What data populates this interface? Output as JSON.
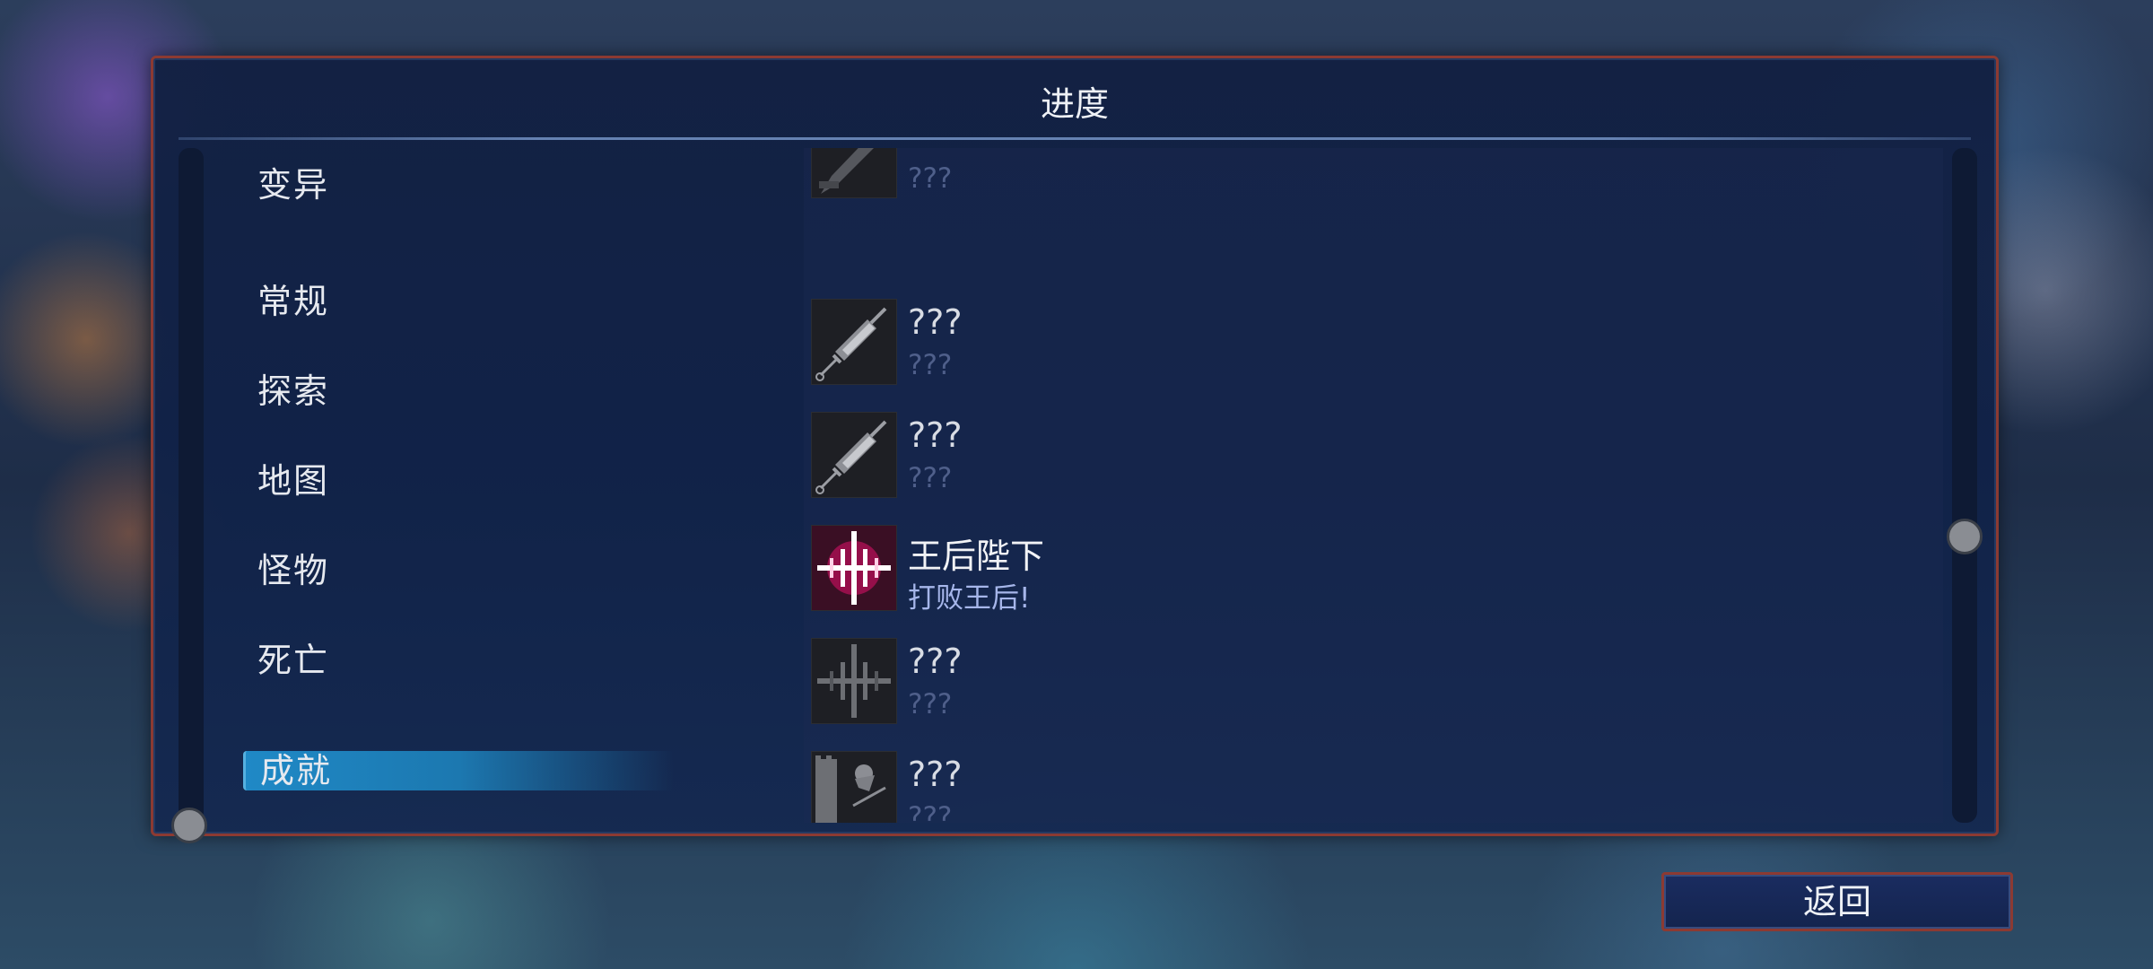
{
  "panel": {
    "title": "进度"
  },
  "categories": [
    {
      "label": "变异",
      "active": false
    },
    {
      "label": "常规",
      "active": false
    },
    {
      "label": "探索",
      "active": false
    },
    {
      "label": "地图",
      "active": false
    },
    {
      "label": "怪物",
      "active": false
    },
    {
      "label": "死亡",
      "active": false
    },
    {
      "label": "成就",
      "active": true
    }
  ],
  "achievements": [
    {
      "name": "???",
      "desc": "???",
      "icon": "sword-icon",
      "unlocked": false
    },
    {
      "name": "???",
      "desc": "???",
      "icon": "syringe-icon",
      "unlocked": false
    },
    {
      "name": "???",
      "desc": "???",
      "icon": "syringe-icon",
      "unlocked": false
    },
    {
      "name": "王后陛下",
      "desc": "打败王后!",
      "icon": "queen-sigil-icon",
      "unlocked": true
    },
    {
      "name": "???",
      "desc": "???",
      "icon": "queen-sigil-icon",
      "unlocked": false
    },
    {
      "name": "???",
      "desc": "???",
      "icon": "tower-icon",
      "unlocked": false
    }
  ],
  "footer": {
    "back_label": "返回"
  },
  "colors": {
    "accent": "#1f89c6",
    "frame": "#8c3a32",
    "unlocked_icon": "#e0106a"
  }
}
